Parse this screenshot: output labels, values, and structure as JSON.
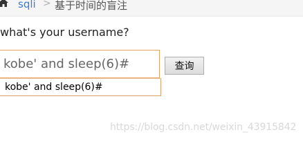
{
  "breadcrumb": {
    "home_icon": "home-icon",
    "link_label": "sqli",
    "separator": ">",
    "current_label": "基于时间的盲注"
  },
  "form": {
    "question": "what's your username?",
    "input_value": "kobe' and sleep(6)#",
    "submit_label": "查询"
  },
  "autocomplete": {
    "suggestions": [
      "kobe' and sleep(6)#"
    ]
  },
  "watermark": {
    "text": "https://blog.csdn.net/weixin_43915842"
  },
  "colors": {
    "link": "#3a7bd5",
    "input_focus_border": "#e8a25a"
  }
}
